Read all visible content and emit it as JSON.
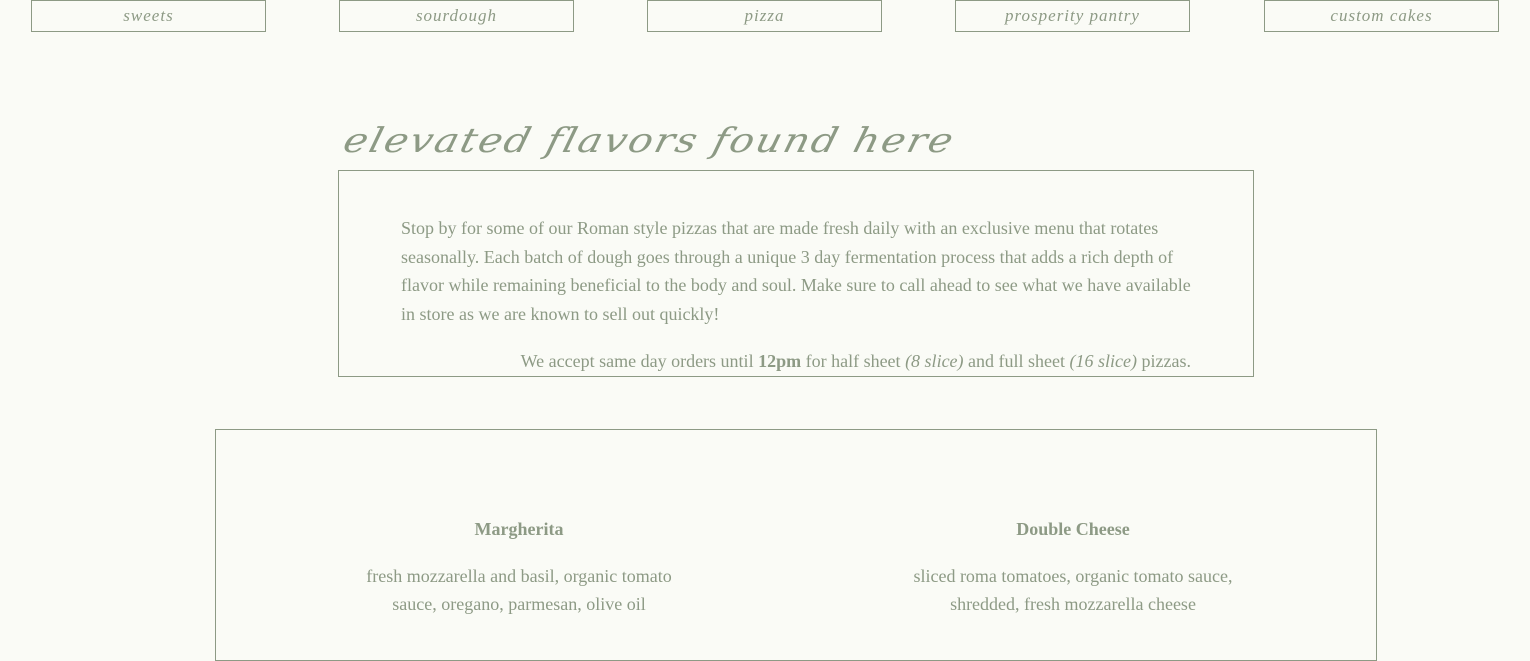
{
  "nav": {
    "items": [
      {
        "label": "sweets"
      },
      {
        "label": "sourdough"
      },
      {
        "label": "pizza"
      },
      {
        "label": "prosperity pantry"
      },
      {
        "label": "custom cakes"
      }
    ]
  },
  "intro": {
    "title": "elevated flavors found here",
    "body": "Stop by for some of our Roman style pizzas that are made fresh daily with an exclusive menu that rotates seasonally. Each batch of dough goes through a unique 3 day fermentation process that adds a rich depth of flavor while remaining beneficial to the body and soul. Make sure to call ahead to see what we have available in store as we are known to sell out quickly!",
    "orders": {
      "prefix": "We accept same day orders until ",
      "time": "12pm",
      "middle1": " for half sheet ",
      "half": "(8 slice)",
      "middle2": " and full sheet ",
      "full": "(16 slice)",
      "suffix": " pizzas."
    }
  },
  "menu": {
    "items": [
      {
        "name": "Margherita",
        "description": "fresh mozzarella and basil, organic tomato sauce, oregano, parmesan, olive oil"
      },
      {
        "name": "Double Cheese",
        "description": "sliced roma tomatoes, organic tomato sauce, shredded, fresh mozzarella cheese"
      }
    ]
  },
  "colors": {
    "background": "#fafbf6",
    "accent": "#8d9a85"
  }
}
